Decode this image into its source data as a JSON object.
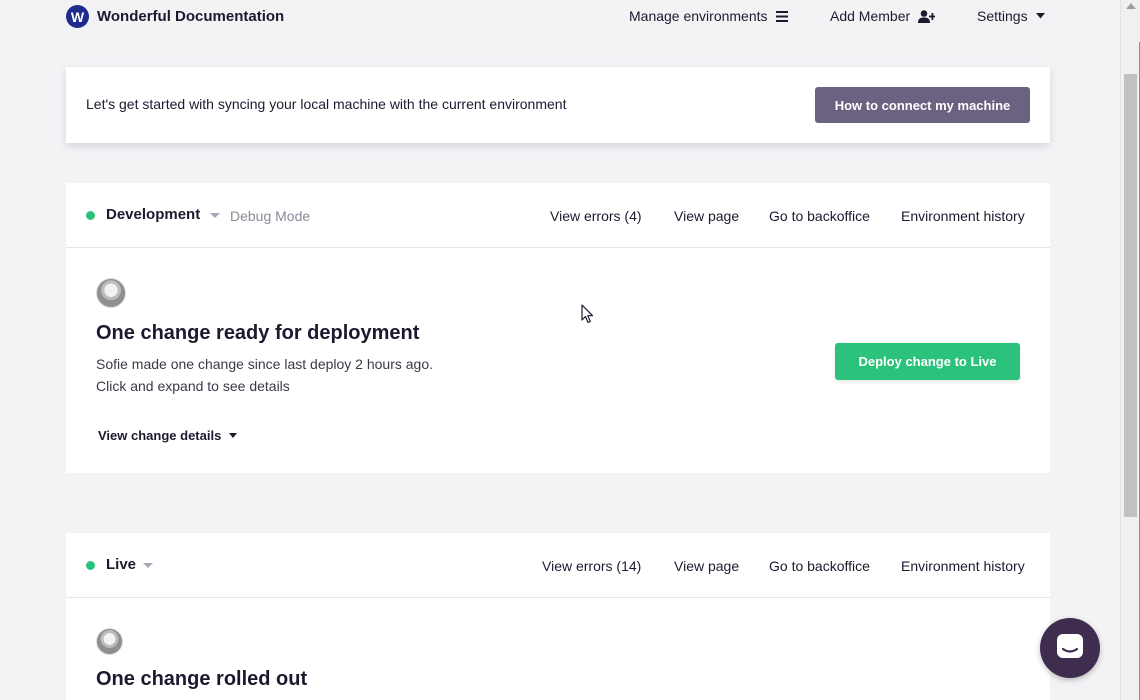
{
  "brand": {
    "logo_letter": "W",
    "name": "Wonderful Documentation"
  },
  "nav": {
    "manage_environments": "Manage environments",
    "add_member": "Add Member",
    "settings": "Settings"
  },
  "banner": {
    "text": "Let's get started with syncing your local machine with the current environment",
    "button": "How to connect my machine"
  },
  "environments": [
    {
      "name": "Development",
      "mode": "Debug Mode",
      "status_color": "#2bc37c",
      "links": [
        "View errors (4)",
        "View page",
        "Go to backoffice",
        "Environment history"
      ],
      "title": "One change ready for deployment",
      "line1": "Sofie made one change since last deploy 2 hours ago.",
      "line2": "Click and expand to see details",
      "details_toggle": "View change details",
      "action_button": "Deploy change to Live"
    },
    {
      "name": "Live",
      "status_color": "#2bc37c",
      "links": [
        "View errors (14)",
        "View page",
        "Go to backoffice",
        "Environment history"
      ],
      "title": "One change rolled out"
    }
  ],
  "colors": {
    "accent_green": "#2bc37c",
    "button_purple": "#6b6180",
    "brand_blue": "#1f2b8f",
    "chat_bubble": "#3e2d4f",
    "background": "#f3f3f6"
  },
  "icons": {
    "manage_environments": "hamburger-menu-icon",
    "add_member": "add-user-icon",
    "settings": "caret-down-icon",
    "chat": "chat-icon"
  }
}
